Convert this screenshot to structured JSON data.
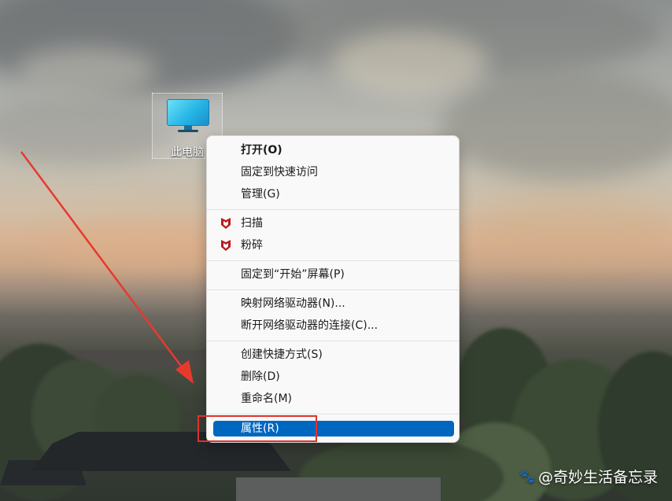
{
  "desktop": {
    "icon_label": "此电脑",
    "icon_name": "monitor-icon"
  },
  "context_menu": {
    "items": [
      {
        "label": "打开(O)",
        "bold": true
      },
      {
        "label": "固定到快速访问"
      },
      {
        "label": "管理(G)"
      },
      {
        "label": "扫描",
        "icon": "mcafee-icon"
      },
      {
        "label": "粉碎",
        "icon": "mcafee-icon"
      },
      {
        "label": "固定到“开始”屏幕(P)"
      },
      {
        "label": "映射网络驱动器(N)..."
      },
      {
        "label": "断开网络驱动器的连接(C)..."
      },
      {
        "label": "创建快捷方式(S)"
      },
      {
        "label": "删除(D)"
      },
      {
        "label": "重命名(M)"
      },
      {
        "label": "属性(R)",
        "selected": true
      }
    ]
  },
  "annotations": {
    "highlight_color": "#e0312d",
    "highlight_target": "属性(R)"
  },
  "watermark": {
    "text": "@奇妙生活备忘录",
    "icon": "paw-icon"
  },
  "colors": {
    "selection": "#0067c0",
    "mcafee_red": "#c01818"
  }
}
